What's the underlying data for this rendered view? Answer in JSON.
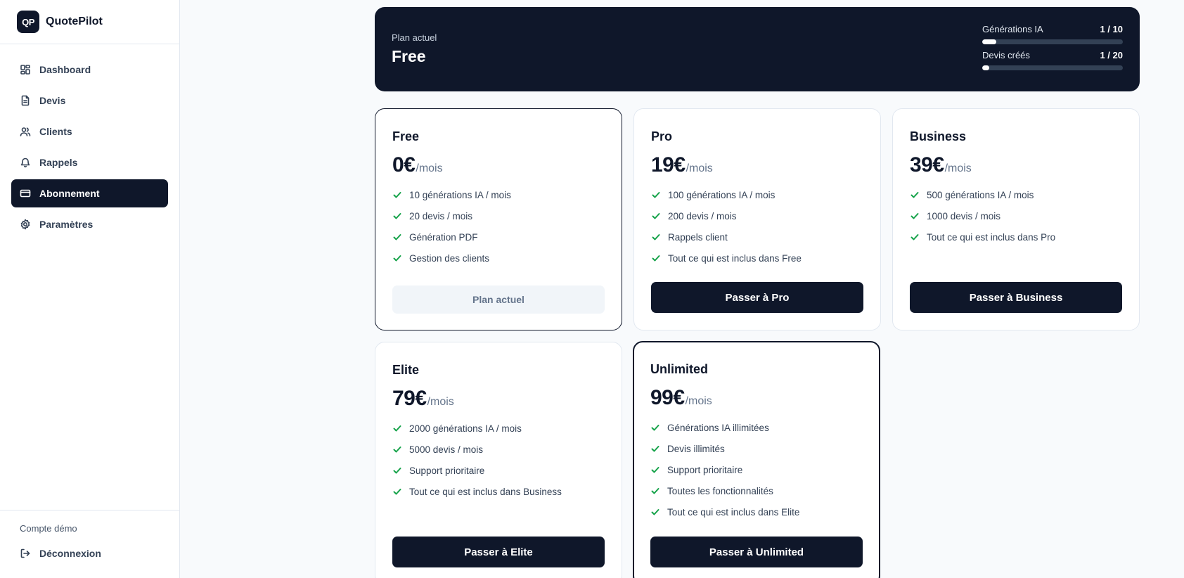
{
  "app": {
    "logo": "QP",
    "name": "QuotePilot"
  },
  "sidebar": {
    "items": [
      {
        "label": "Dashboard",
        "icon": "dashboard-icon"
      },
      {
        "label": "Devis",
        "icon": "document-icon"
      },
      {
        "label": "Clients",
        "icon": "users-icon"
      },
      {
        "label": "Rappels",
        "icon": "bell-icon"
      },
      {
        "label": "Abonnement",
        "icon": "credit-card-icon",
        "active": true
      },
      {
        "label": "Paramètres",
        "icon": "gear-icon"
      }
    ],
    "account": "Compte démo",
    "logout": "Déconnexion"
  },
  "banner": {
    "label": "Plan actuel",
    "plan": "Free",
    "usage": [
      {
        "label": "Générations IA",
        "value": "1 / 10",
        "used": 1,
        "limit": 10
      },
      {
        "label": "Devis créés",
        "value": "1 / 20",
        "used": 1,
        "limit": 20
      }
    ]
  },
  "plans": [
    {
      "name": "Free",
      "price": "0€",
      "per": "/mois",
      "features": [
        "10 générations IA / mois",
        "20 devis / mois",
        "Génération PDF",
        "Gestion des clients"
      ],
      "button": "Plan actuel",
      "current": true
    },
    {
      "name": "Pro",
      "price": "19€",
      "per": "/mois",
      "features": [
        "100 générations IA / mois",
        "200 devis / mois",
        "Rappels client",
        "Tout ce qui est inclus dans Free"
      ],
      "button": "Passer à Pro"
    },
    {
      "name": "Business",
      "price": "39€",
      "per": "/mois",
      "features": [
        "500 générations IA / mois",
        "1000 devis / mois",
        "Tout ce qui est inclus dans Pro"
      ],
      "button": "Passer à Business"
    },
    {
      "name": "Elite",
      "price": "79€",
      "per": "/mois",
      "features": [
        "2000 générations IA / mois",
        "5000 devis / mois",
        "Support prioritaire",
        "Tout ce qui est inclus dans Business"
      ],
      "button": "Passer à Elite"
    },
    {
      "name": "Unlimited",
      "price": "99€",
      "per": "/mois",
      "features": [
        "Générations IA illimitées",
        "Devis illimités",
        "Support prioritaire",
        "Toutes les fonctionnalités",
        "Tout ce qui est inclus dans Elite"
      ],
      "button": "Passer à Unlimited",
      "featured": true
    }
  ]
}
